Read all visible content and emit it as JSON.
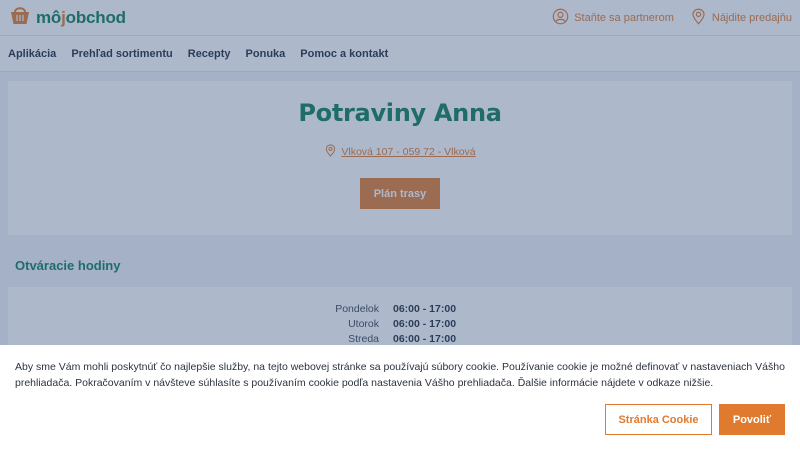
{
  "header": {
    "logo": {
      "part1": "mô",
      "part2": "j",
      "part3": "obchod",
      "icon": "basket-icon"
    },
    "links": [
      {
        "label": "Staňte sa partnerom",
        "icon": "user-circle-icon"
      },
      {
        "label": "Nájdite predajňu",
        "icon": "location-pin-icon"
      }
    ]
  },
  "nav": {
    "items": [
      "Aplikácia",
      "Prehľad sortimentu",
      "Recepty",
      "Ponuka",
      "Pomoc a kontakt"
    ]
  },
  "store": {
    "name": "Potraviny Anna",
    "address": "Vlková 107 - 059 72 - Vlková",
    "route_button": "Plán trasy"
  },
  "hours": {
    "title": "Otváracie hodiny",
    "rows": [
      {
        "day": "Pondelok",
        "time": "06:00 - 17:00"
      },
      {
        "day": "Utorok",
        "time": "06:00 - 17:00"
      },
      {
        "day": "Streda",
        "time": "06:00 - 17:00"
      }
    ]
  },
  "cookie": {
    "text": "Aby sme Vám mohli poskytnúť čo najlepšie služby, na tejto webovej stránke sa používajú súbory cookie. Používanie cookie je možné definovať v nastaveniach Vášho prehliadača. Pokračovaním v návšteve súhlasíte s používaním cookie podľa nastavenia Vášho prehliadača. Ďalšie informácie nájdete v odkaze nižšie.",
    "settings_button": "Stránka Cookie",
    "accept_button": "Povoliť"
  },
  "colors": {
    "brand_green": "#0c7d56",
    "brand_orange": "#e07a2f"
  }
}
